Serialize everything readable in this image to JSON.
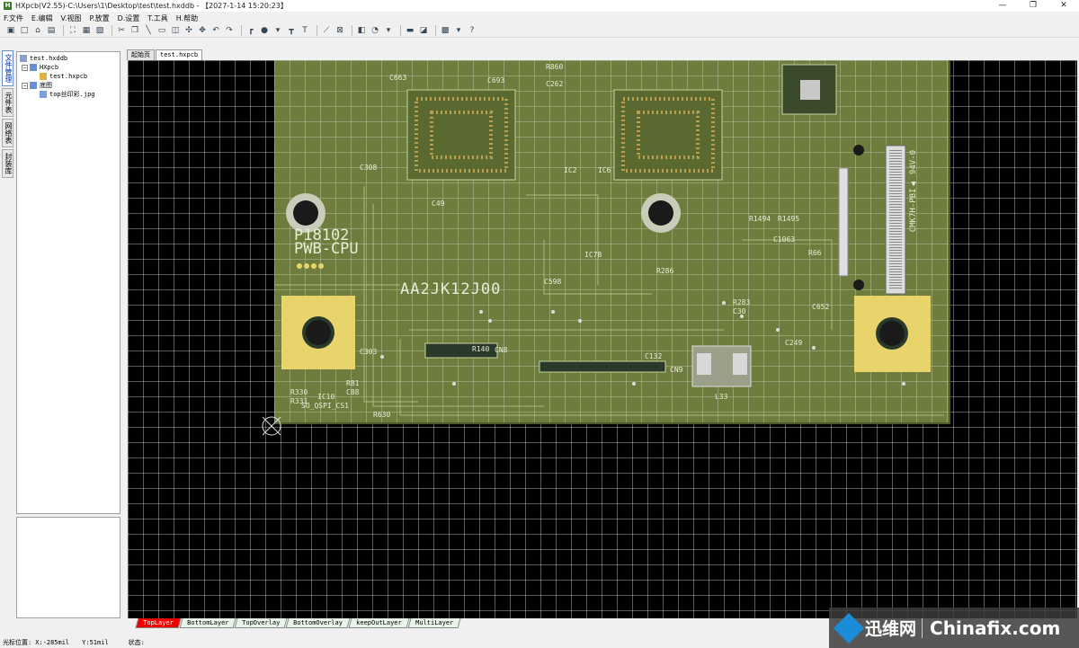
{
  "window": {
    "title": "HXpcb(V2.55)-C:\\Users\\1\\Desktop\\test\\test.hxddb - 【2027-1-14 15:20:23】",
    "app_icon_text": "H",
    "minimize": "—",
    "maximize": "❐",
    "close": "✕"
  },
  "menu": [
    "F.文件",
    "E.编辑",
    "V.视图",
    "P.放置",
    "D.设置",
    "T.工具",
    "H.帮助"
  ],
  "toolbar_icons": [
    "new-project-icon",
    "new-file-icon",
    "open-icon",
    "save-icon",
    "print-icon",
    "zoom-fit-icon",
    "zoom-area-icon",
    "zoom-page-icon",
    "select-icon",
    "copy-icon",
    "line-icon",
    "rect-icon",
    "component-icon",
    "net-icon",
    "move-icon",
    "undo-icon",
    "redo-icon",
    "route-icon",
    "via-icon",
    "dropdown-icon",
    "pad-icon",
    "text-icon",
    "measure-icon",
    "delete-icon",
    "layer-icon",
    "drc-icon",
    "dropdown-icon",
    "highlight-icon",
    "board-icon",
    "grid-icon",
    "dropdown-icon",
    "help-icon"
  ],
  "sidebar_tabs": [
    "文件管理",
    "元件表",
    "网络表",
    "封装库"
  ],
  "tree": {
    "root": "test.hxddb",
    "group1": "HXpcb",
    "file1": "test.hxpcb",
    "group2": "底图",
    "file2": "top丝印彩.jpg"
  },
  "doc_tabs": [
    "起始页",
    "test.hxpcb"
  ],
  "pcb_labels": {
    "board_code": "AA2JK12J00",
    "board_name": "PWB-CPU",
    "part_no": "P18102",
    "ul_mark": "CMK7H-PBI▲ 94V-0",
    "chip_label": "SO_QSPI_CS1",
    "ref_ic10": "IC10",
    "ref_cn8": "CN8",
    "ref_cn9": "CN9",
    "ref_l33": "L33",
    "ref_r140": "R140",
    "ref_c132": "C132",
    "ref_ic2": "IC2",
    "ref_ic6": "IC6",
    "ref_ic78": "IC78",
    "ref_c693": "C693",
    "ref_c663": "C663",
    "ref_r860": "R860",
    "ref_c262": "C262",
    "ref_c303": "C303",
    "ref_c308": "C308",
    "ref_c49": "C49",
    "ref_c598": "C598",
    "ref_r286": "R286",
    "ref_c1063": "C1063",
    "ref_r1494": "R1494",
    "ref_r1495": "R1495",
    "ref_r330": "R330",
    "ref_r331": "R331",
    "ref_r630": "R630",
    "ref_r81": "R81",
    "ref_c88": "C88",
    "ref_r283": "R283",
    "ref_c30": "C30",
    "ref_c49b": "C249",
    "ref_r66": "R66",
    "ref_c652": "C652"
  },
  "layer_tabs": [
    "TopLayer",
    "BottomLayer",
    "TopOverlay",
    "BottomOverlay",
    "keepOutLayer",
    "MultiLayer"
  ],
  "status": {
    "cursor_label": "光标位置:",
    "x": "X:-285mil",
    "y": "Y:51mil",
    "state_label": "状态:"
  },
  "watermark": {
    "cn": "迅维网",
    "en": "Chinafix.com"
  },
  "colors": {
    "board": "#6e7d3d",
    "pad_gold": "#e8d46a",
    "canvas": "#000000",
    "active_layer": "#ee0000"
  }
}
